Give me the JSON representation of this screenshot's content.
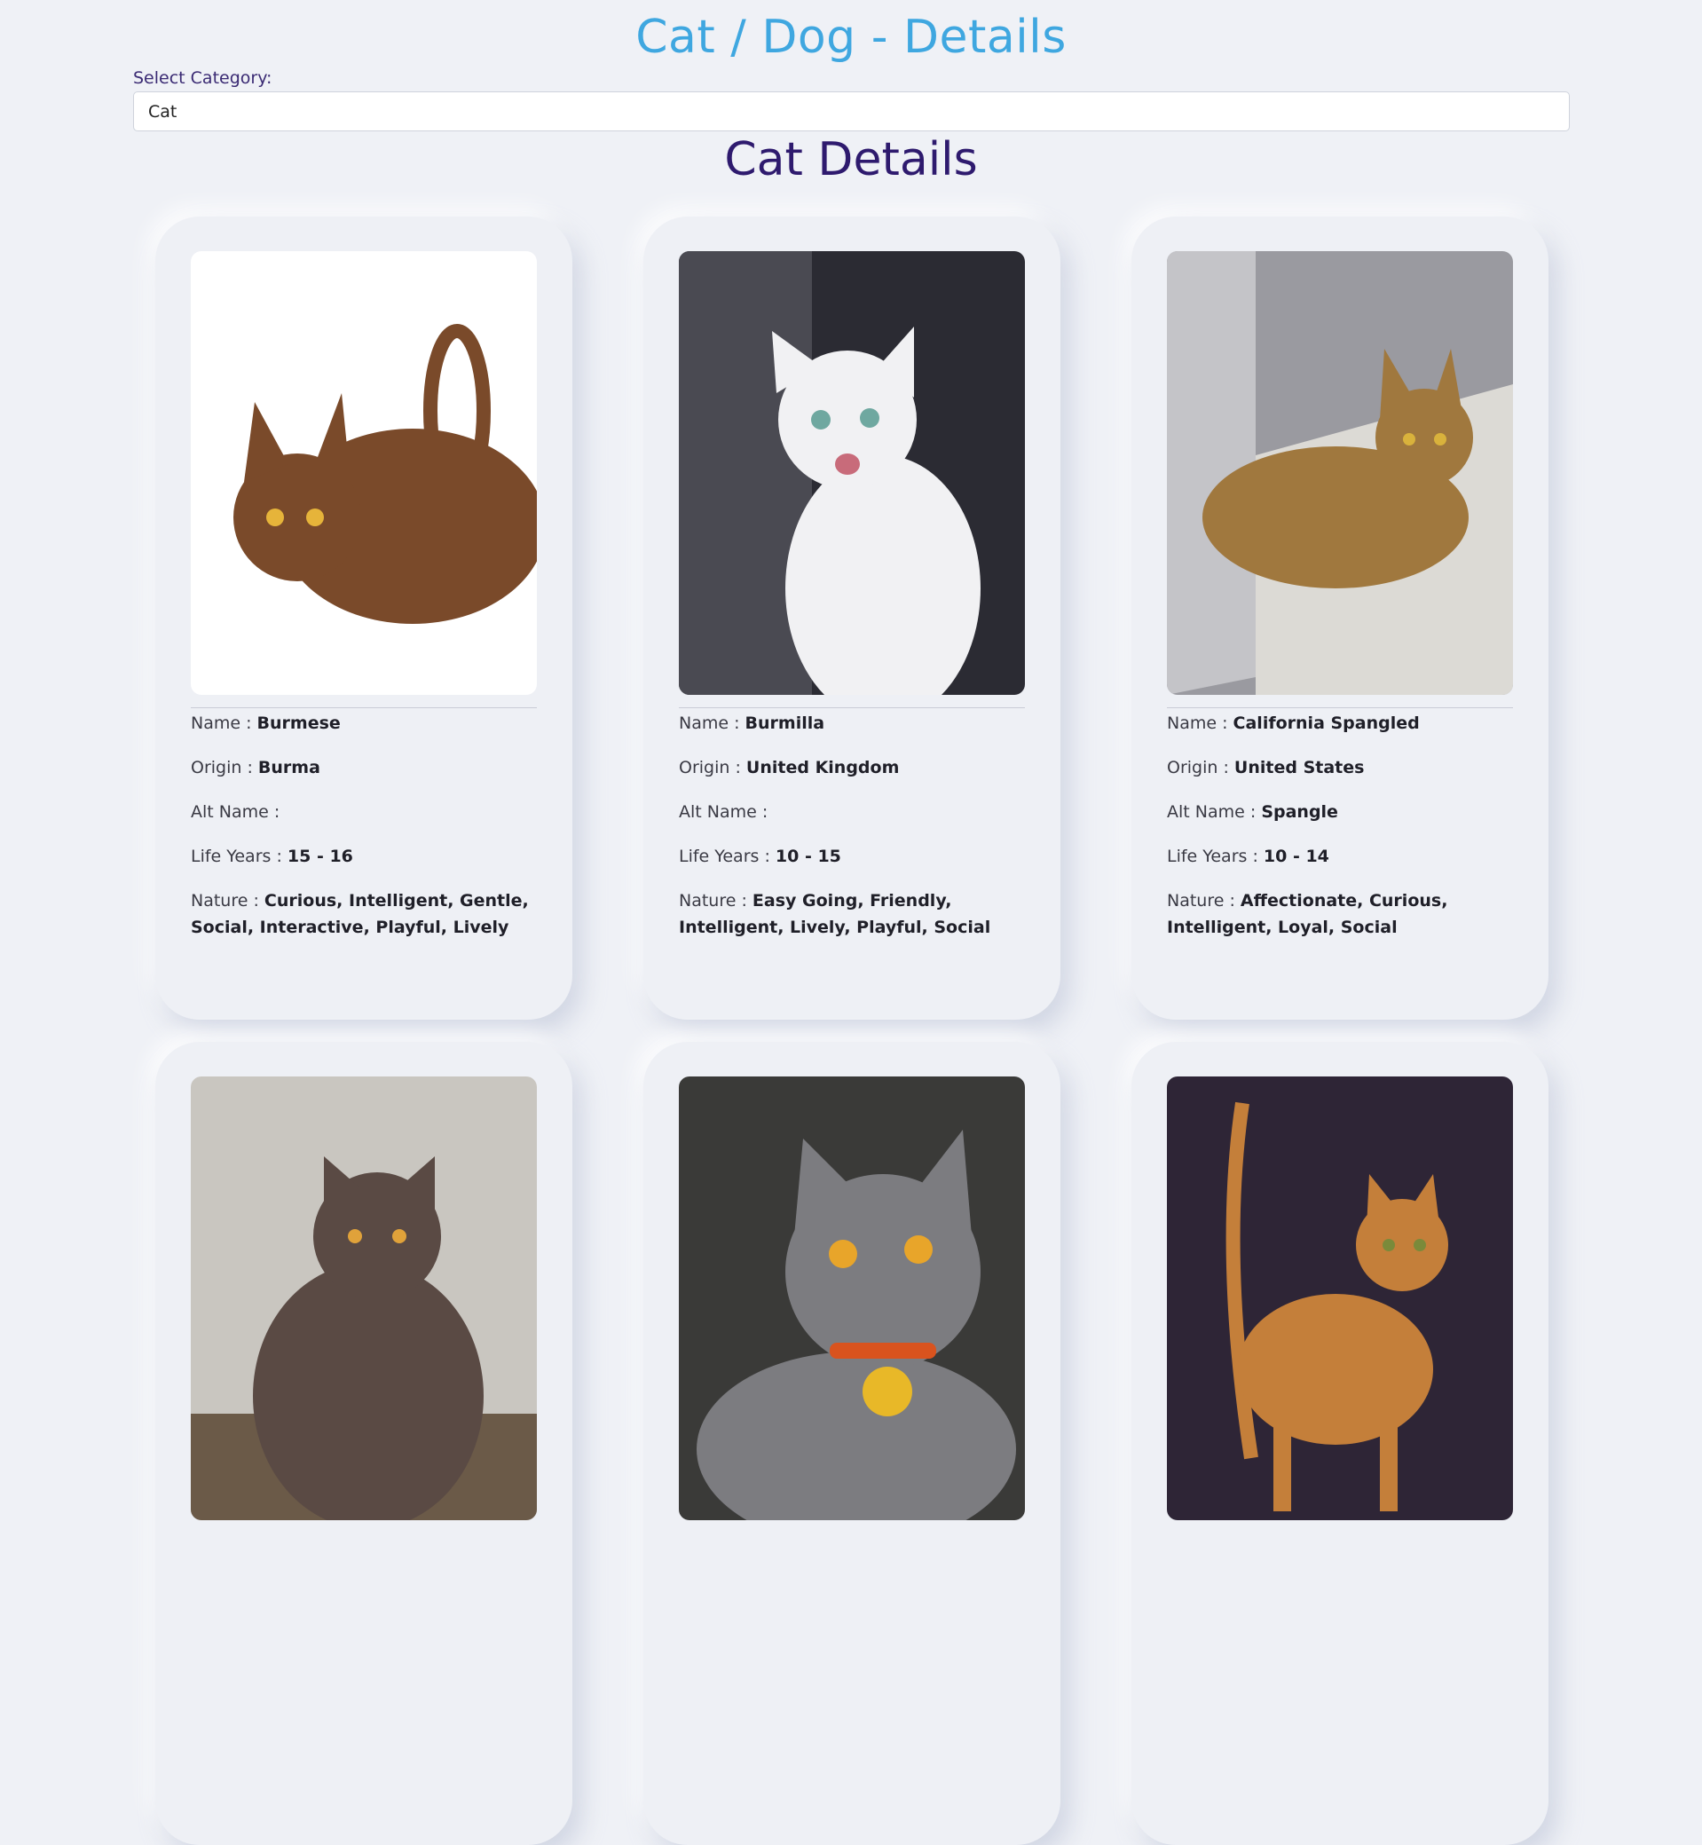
{
  "header": {
    "title": "Cat / Dog - Details",
    "select_label": "Select Category:",
    "select_value": "Cat"
  },
  "section": {
    "title": "Cat Details"
  },
  "labels": {
    "name": "Name : ",
    "origin": "Origin : ",
    "alt_name": "Alt Name : ",
    "life_years": "Life Years : ",
    "nature": "Nature : "
  },
  "cards": [
    {
      "name": "Burmese",
      "origin": "Burma",
      "alt_name": "",
      "life_years": "15 - 16",
      "nature": "Curious, Intelligent, Gentle, Social, Interactive, Playful, Lively",
      "photo_bg": "#ffffff",
      "cat_color": "#7a4a2a"
    },
    {
      "name": "Burmilla",
      "origin": "United Kingdom",
      "alt_name": "",
      "life_years": "10 - 15",
      "nature": "Easy Going, Friendly, Intelligent, Lively, Playful, Social",
      "photo_bg": "#2b2b33",
      "cat_color": "#f1f1f3"
    },
    {
      "name": "California Spangled",
      "origin": "United States",
      "alt_name": "Spangle",
      "life_years": "10 - 14",
      "nature": "Affectionate, Curious, Intelligent, Loyal, Social",
      "photo_bg": "#9a9aa0",
      "cat_color": "#a0783e"
    },
    {
      "photo_bg": "#c9c6c0",
      "cat_color": "#5a4a44"
    },
    {
      "photo_bg": "#3a3a38",
      "cat_color": "#7c7c80"
    },
    {
      "photo_bg": "#2e2536",
      "cat_color": "#c47f3a"
    }
  ]
}
